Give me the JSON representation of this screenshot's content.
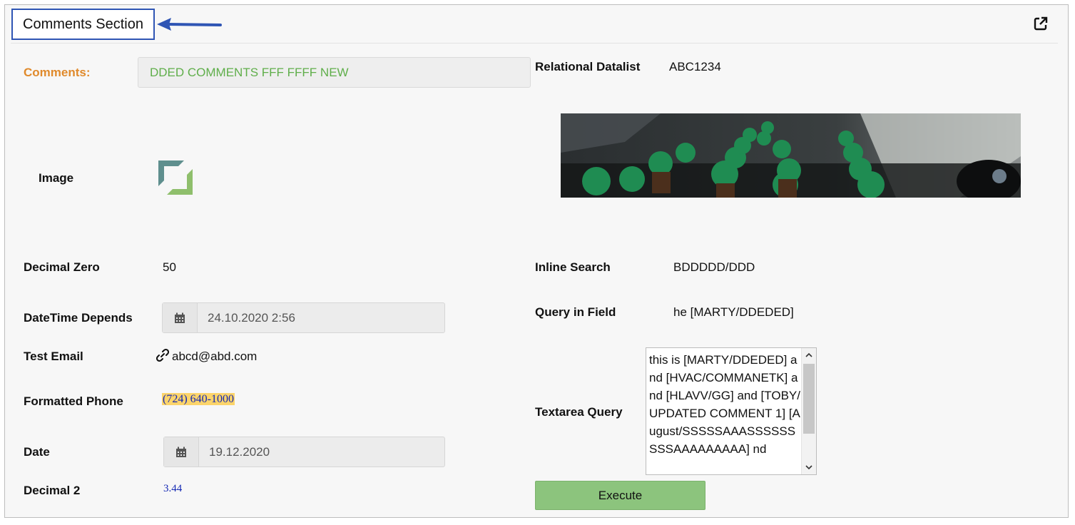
{
  "section": {
    "title": "Comments Section"
  },
  "comments": {
    "label": "Comments:",
    "value": "DDED COMMENTS FFF FFFF NEW"
  },
  "relational_datalist": {
    "label": "Relational Datalist",
    "value": "ABC1234"
  },
  "image": {
    "label": "Image"
  },
  "decimal_zero": {
    "label": "Decimal Zero",
    "value": "50"
  },
  "inline_search": {
    "label": "Inline Search",
    "value": "BDDDDD/DDD"
  },
  "datetime_depends": {
    "label": "DateTime Depends",
    "value": "24.10.2020 2:56"
  },
  "query_in_field": {
    "label": "Query in Field",
    "value": "he [MARTY/DDEDED]"
  },
  "test_email": {
    "label": "Test Email",
    "value": "abcd@abd.com"
  },
  "textarea_query": {
    "label": "Textarea Query",
    "value": "this is [MARTY/DDEDED] and [HVAC/COMMANETK] and [HLAVV/GG] and [TOBY/UPDATED COMMENT 1] [August/SSSSSAAASSSSSSSSSAAAAAAAAA] nd"
  },
  "formatted_phone": {
    "label": "Formatted Phone",
    "value": "(724) 640-1000"
  },
  "date": {
    "label": "Date",
    "value": "19.12.2020"
  },
  "decimal_2": {
    "label": "Decimal 2",
    "value": "3.44"
  },
  "execute": {
    "label": "Execute"
  },
  "colors": {
    "accent_blue": "#2f55b4",
    "comments_label": "#e08a2c",
    "comments_text": "#5fae4a",
    "execute_button": "#8cc47d",
    "phone_highlight": "#fcd46a"
  }
}
